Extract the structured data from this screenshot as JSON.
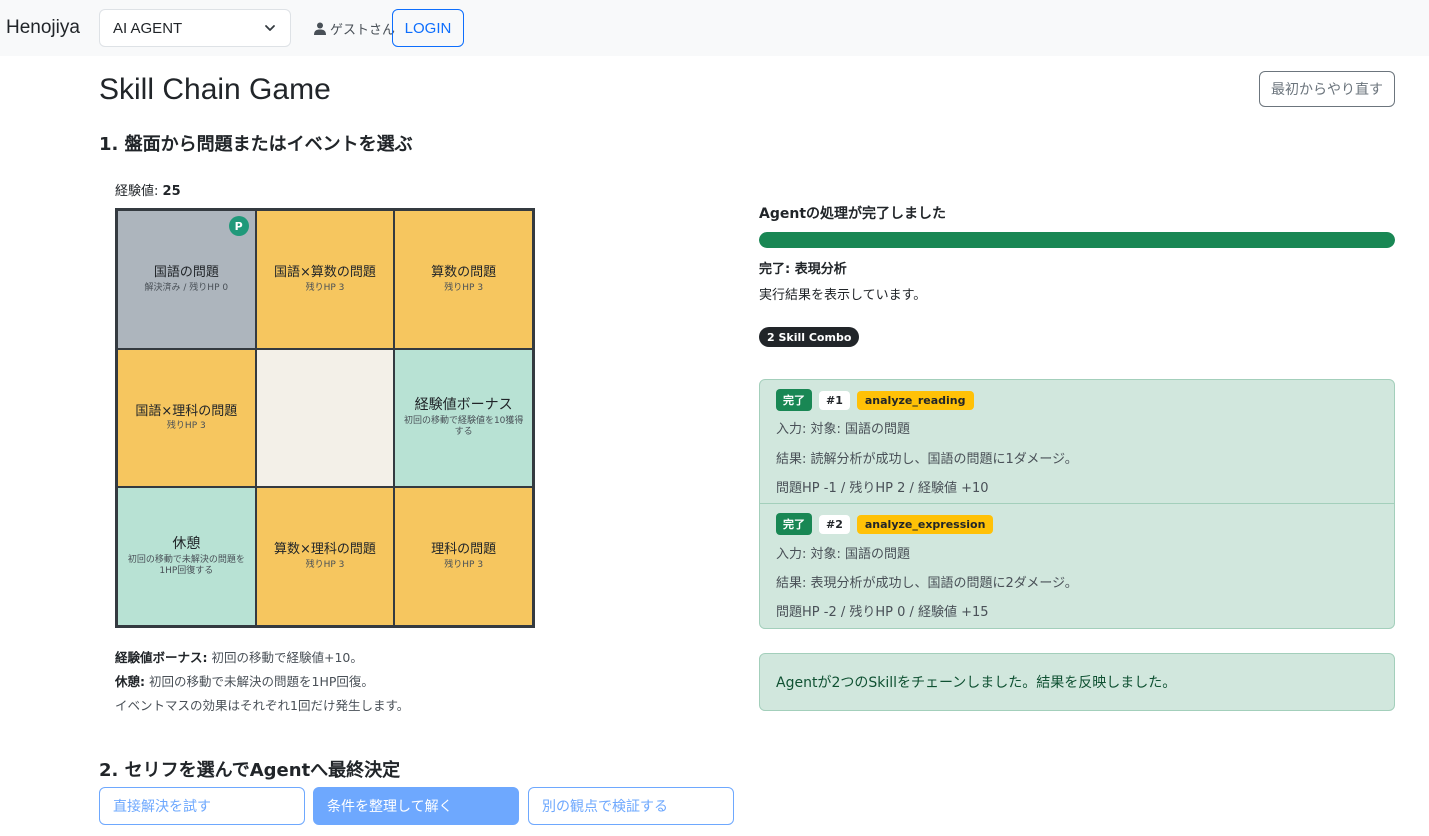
{
  "navbar": {
    "brand": "Henojiya",
    "agent_select": "AI AGENT",
    "guest": "ゲストさん",
    "login": "LOGIN"
  },
  "page": {
    "title": "Skill Chain Game",
    "restart": "最初からやり直す",
    "step1_heading": "1. 盤面から問題またはイベントを選ぶ",
    "exp_label": "経験値:",
    "exp_value": "25"
  },
  "board": {
    "cells": [
      {
        "title": "国語の問題",
        "sub": "解決済み / 残りHP 0",
        "badge": "P"
      },
      {
        "title": "国語×算数の問題",
        "sub": "残りHP 3"
      },
      {
        "title": "算数の問題",
        "sub": "残りHP 3"
      },
      {
        "title": "国語×理科の問題",
        "sub": "残りHP 3"
      },
      {
        "title": "",
        "sub": ""
      },
      {
        "title": "経験値ボーナス",
        "sub": "初回の移動で経験値を10獲得する"
      },
      {
        "title": "休憩",
        "sub": "初回の移動で未解決の問題を1HP回復する"
      },
      {
        "title": "算数×理科の問題",
        "sub": "残りHP 3"
      },
      {
        "title": "理科の問題",
        "sub": "残りHP 3"
      }
    ]
  },
  "notes": {
    "bonus_label": "経験値ボーナス:",
    "bonus_text": "初回の移動で経験値+10。",
    "rest_label": "休憩:",
    "rest_text": "初回の移動で未解決の問題を1HP回復。",
    "event_note": "イベントマスの効果はそれぞれ1回だけ発生します。"
  },
  "step2": {
    "heading": "2. セリフを選んでAgentへ最終決定",
    "options": [
      "直接解決を試す",
      "条件を整理して解く",
      "別の観点で検証する"
    ]
  },
  "status": {
    "title": "Agentの処理が完了しました",
    "progress": 1.0,
    "done_line": "完了: 表現分析",
    "result_line": "実行結果を表示しています。",
    "combo": "2 Skill Combo"
  },
  "steps": [
    {
      "state": "完了",
      "num": "#1",
      "skill": "analyze_reading",
      "input": "入力: 対象: 国語の問題",
      "result": "結果: 読解分析が成功し、国語の問題に1ダメージ。",
      "effect": "問題HP -1 / 残りHP 2 / 経験値 +10"
    },
    {
      "state": "完了",
      "num": "#2",
      "skill": "analyze_expression",
      "input": "入力: 対象: 国語の問題",
      "result": "結果: 表現分析が成功し、国語の問題に2ダメージ。",
      "effect": "問題HP -2 / 残りHP 0 / 経験値 +15"
    }
  ],
  "final_message": "Agentが2つのSkillをチェーンしました。結果を反映しました。",
  "colors": {
    "problem": "#f6c65f",
    "solved": "#adb5bd",
    "event": "#b8e2d4",
    "empty": "#f3f0e8",
    "success": "#198754",
    "primary": "#0d6efd"
  }
}
